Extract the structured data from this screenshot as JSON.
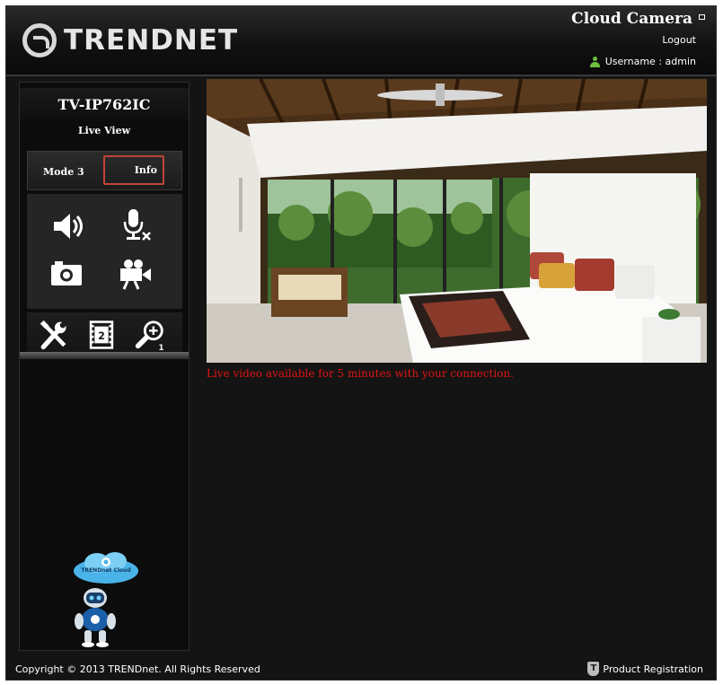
{
  "header": {
    "brand": "TRENDNET",
    "app_title": "Cloud Camera",
    "logout": "Logout",
    "username_label": "Username : admin"
  },
  "sidebar": {
    "model": "TV-IP762IC",
    "live_view": "Live View",
    "mode": "Mode 3",
    "info": "Info",
    "controls": [
      "speaker-icon",
      "microphone-muted-icon",
      "snapshot-camera-icon",
      "video-record-icon"
    ],
    "tools": [
      "settings-tools-icon",
      "film-strip-icon",
      "zoom-in-icon"
    ],
    "mascot_label": "TRENDnet Cloud"
  },
  "main": {
    "notice": "Live video available for 5 minutes with your connection."
  },
  "footer": {
    "copyright": "Copyright © 2013 TRENDnet. All Rights Reserved",
    "product_registration": "Product Registration"
  },
  "colors": {
    "background": "#141414",
    "notice": "#e01414",
    "info_highlight": "#c0443a",
    "user_icon": "#6bbf3a"
  }
}
